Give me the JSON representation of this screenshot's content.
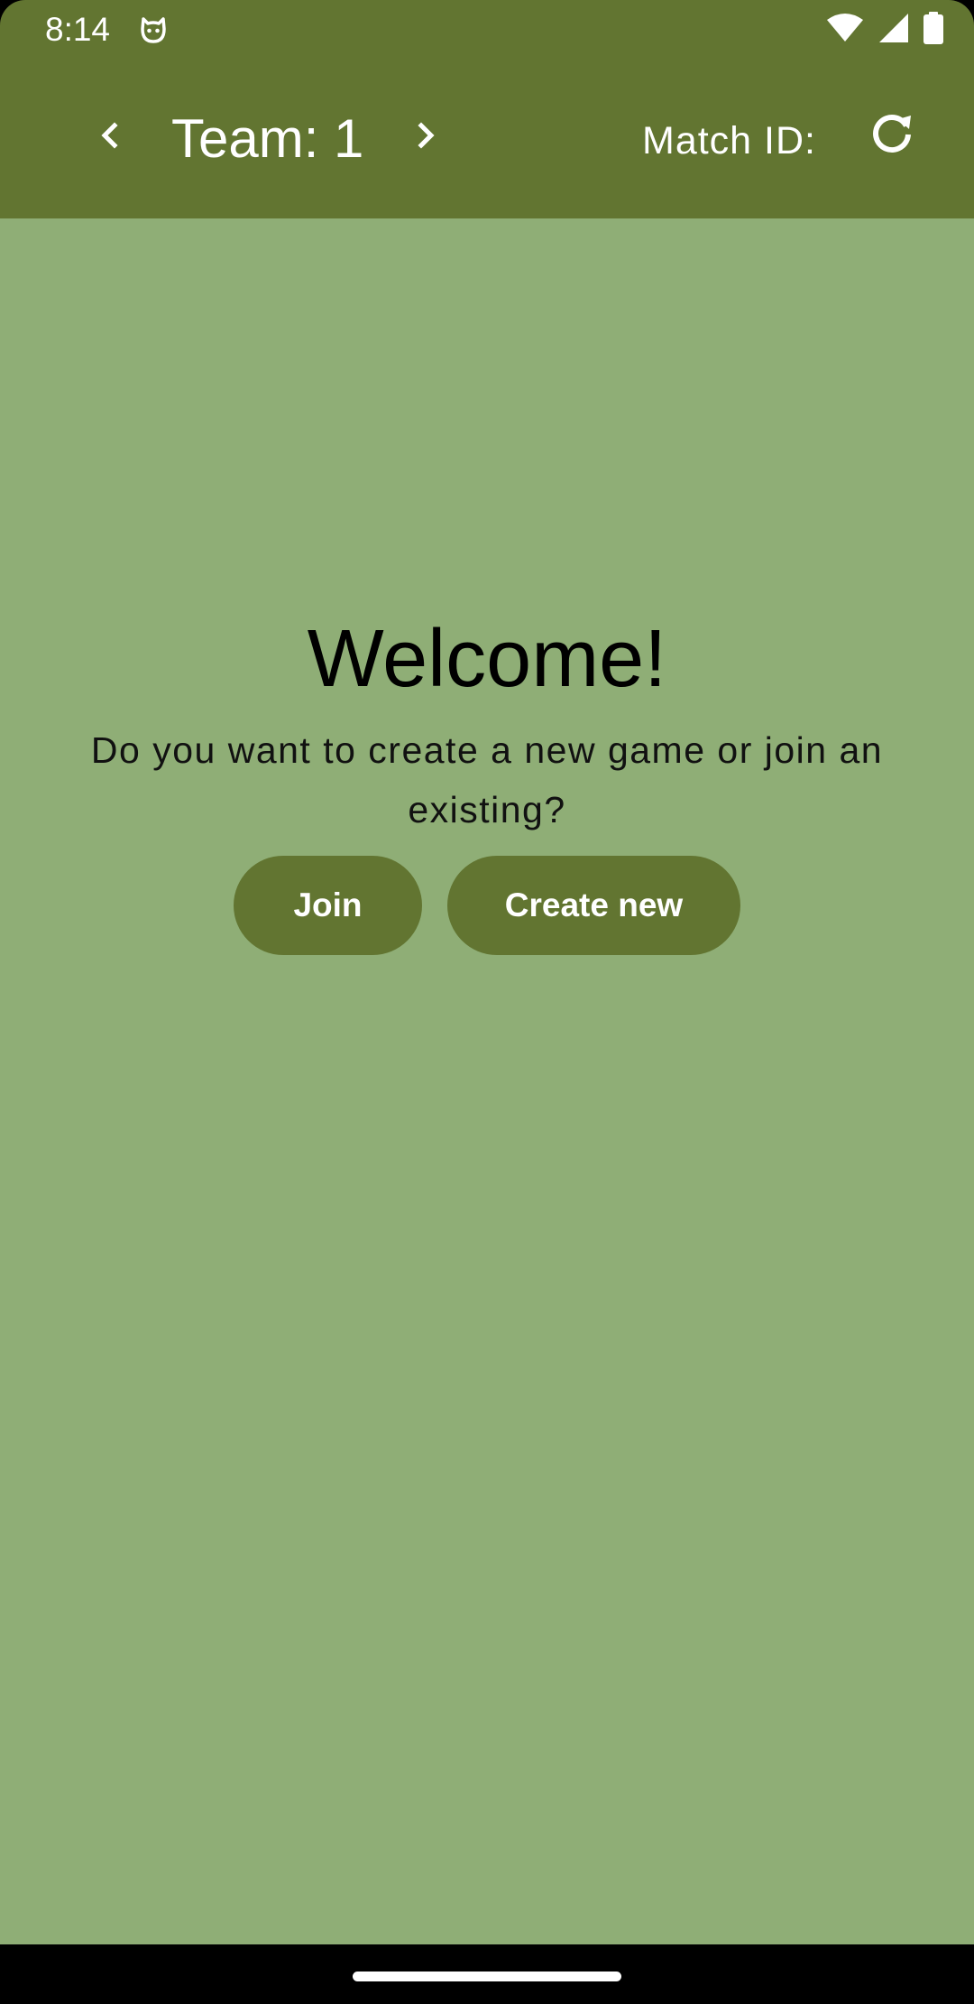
{
  "status_bar": {
    "time": "8:14",
    "icons": [
      "cat-app-icon",
      "wifi-icon",
      "signal-icon",
      "battery-icon"
    ]
  },
  "app_bar": {
    "team_label": "Team: 1",
    "match_id_label": "Match ID:",
    "icons": [
      "chevron-left-icon",
      "chevron-right-icon",
      "refresh-icon"
    ]
  },
  "main": {
    "welcome": "Welcome!",
    "question": "Do you want to create a new game or join an existing?",
    "join_label": "Join",
    "create_label": "Create new"
  },
  "colors": {
    "primary": "#627531",
    "background": "#8fae76",
    "on_primary": "#ffffff"
  }
}
